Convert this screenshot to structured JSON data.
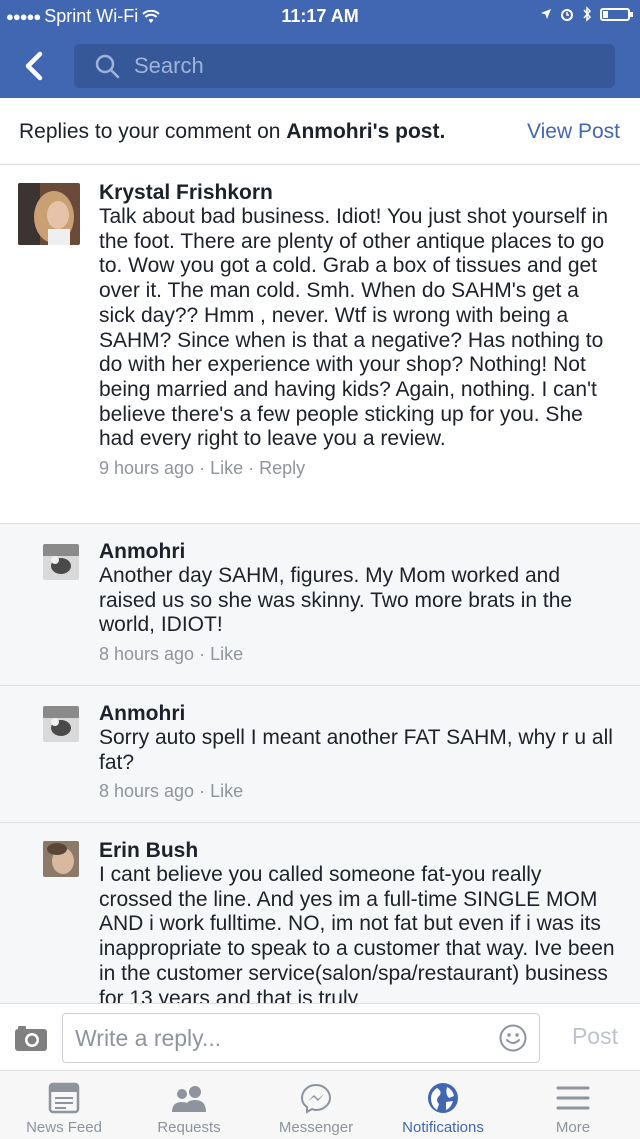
{
  "status_bar": {
    "carrier": "Sprint Wi-Fi",
    "time": "11:17 AM"
  },
  "nav": {
    "search_placeholder": "Search"
  },
  "header": {
    "title_prefix": "Replies to your comment on ",
    "post_owner": "Anmohri's post.",
    "view_post": "View Post"
  },
  "comments": [
    {
      "name": "Krystal Frishkorn",
      "text": "Talk about bad business. Idiot! You just shot yourself in the foot. There are plenty of other antique places to go to. Wow you got a cold. Grab a box of tissues and get over it. The man cold. Smh. When do SAHM's get a sick day?? Hmm , never. Wtf is wrong with being a SAHM? Since when is that a negative? Has nothing to do with her experience with your shop? Nothing! Not being married and having kids? Again, nothing. I can't believe there's a few people sticking up for you. She had every right to leave you a review.",
      "time": "9 hours ago",
      "like": "Like",
      "reply": "Reply"
    },
    {
      "name": "Anmohri",
      "text": "Another day SAHM, figures.  My Mom worked and raised us so she was skinny.  Two more brats in the world, IDIOT!",
      "time": "8 hours ago",
      "like": "Like"
    },
    {
      "name": "Anmohri",
      "text": "Sorry auto spell I meant another FAT SAHM, why r u all fat?",
      "time": "8 hours ago",
      "like": "Like"
    },
    {
      "name": "Erin Bush",
      "text": "I cant believe you called someone fat-you really crossed the line. And yes im a full-time SINGLE MOM AND i work fulltime. NO, im not fat but even if i was its inappropriate to speak to a customer that way. Ive been in the customer service(salon/spa/restaurant) business for 13 years and that is truly"
    }
  ],
  "composer": {
    "placeholder": "Write a reply...",
    "post_label": "Post"
  },
  "tabs": [
    {
      "label": "News Feed",
      "icon": "news-feed-icon"
    },
    {
      "label": "Requests",
      "icon": "friend-requests-icon"
    },
    {
      "label": "Messenger",
      "icon": "messenger-icon"
    },
    {
      "label": "Notifications",
      "icon": "globe-icon",
      "active": true
    },
    {
      "label": "More",
      "icon": "menu-icon"
    }
  ],
  "colors": {
    "brand": "#4267b2",
    "reply_bg": "#f6f7f9",
    "meta_text": "#90949c"
  }
}
